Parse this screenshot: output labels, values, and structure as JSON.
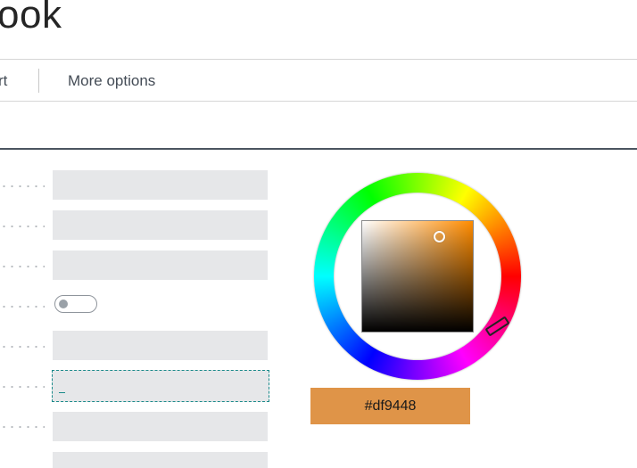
{
  "header": {
    "title": "ook"
  },
  "toolbar": {
    "cut_label": "rt",
    "more_options_label": "More options"
  },
  "form": {
    "focused_value": "_",
    "toggle_on": false
  },
  "color_picker": {
    "hex_value": "#df9448",
    "selected_color": "#df9448",
    "hue_color": "#ff8c00"
  }
}
